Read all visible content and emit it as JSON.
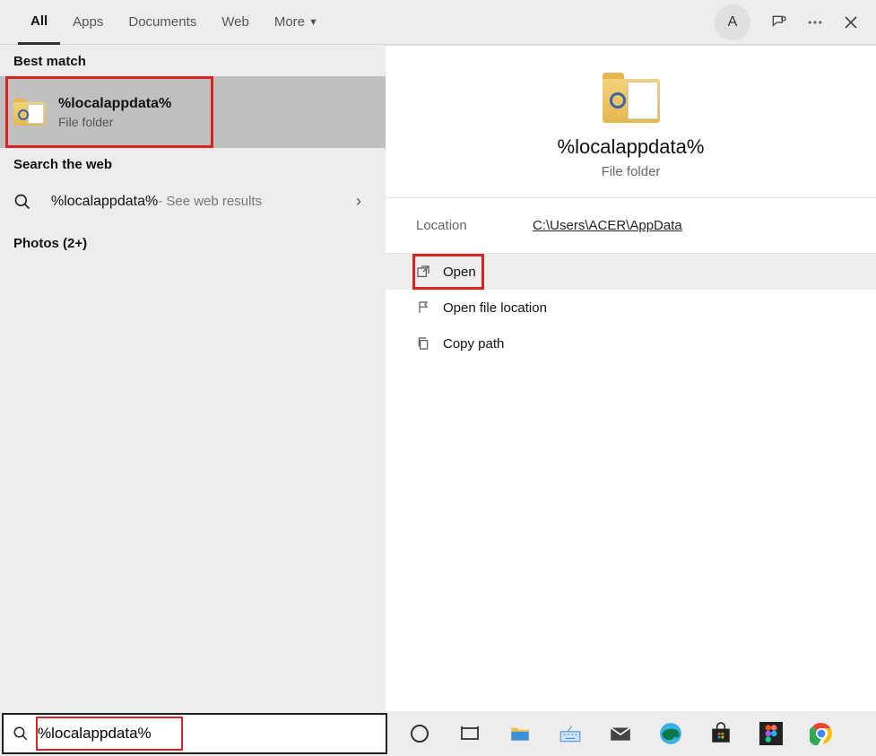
{
  "tabs": {
    "all": "All",
    "apps": "Apps",
    "documents": "Documents",
    "web": "Web",
    "more": "More"
  },
  "avatar_initial": "A",
  "left": {
    "best_match_header": "Best match",
    "result": {
      "title": "%localappdata%",
      "subtitle": "File folder"
    },
    "search_web_header": "Search the web",
    "web": {
      "query": "%localappdata%",
      "suffix": " - See web results"
    },
    "photos": "Photos (2+)"
  },
  "right": {
    "title": "%localappdata%",
    "subtitle": "File folder",
    "location_label": "Location",
    "location_value": "C:\\Users\\ACER\\AppData",
    "actions": {
      "open": "Open",
      "open_loc": "Open file location",
      "copy_path": "Copy path"
    }
  },
  "search": {
    "value": "%localappdata%"
  }
}
